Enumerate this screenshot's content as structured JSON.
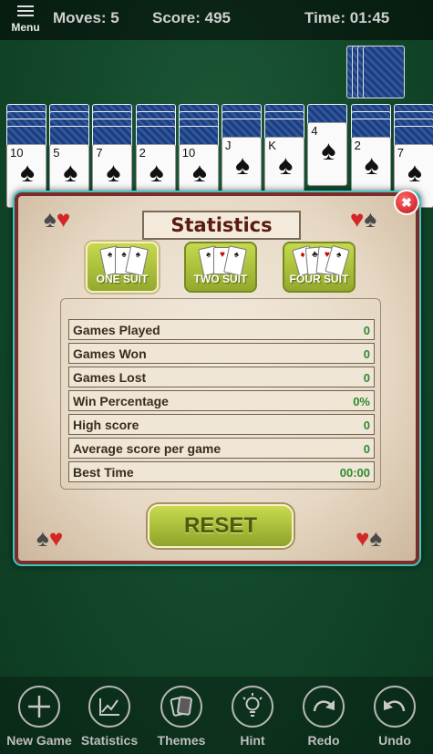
{
  "topbar": {
    "menu_label": "Menu",
    "moves": "Moves: 5",
    "score": "Score: 495",
    "time": "Time: 01:45"
  },
  "board": {
    "columns": [
      {
        "backs": 4,
        "face_rank": "10",
        "face_suit": "♠"
      },
      {
        "backs": 4,
        "face_rank": "5",
        "face_suit": "♠"
      },
      {
        "backs": 4,
        "face_rank": "7",
        "face_suit": "♠"
      },
      {
        "backs": 4,
        "face_rank": "2",
        "face_suit": "♠"
      },
      {
        "backs": 4,
        "face_rank": "10",
        "face_suit": "♠"
      },
      {
        "backs": 3,
        "face_rank": "J",
        "face_suit": "♠"
      },
      {
        "backs": 3,
        "face_rank": "K",
        "face_suit": "♠"
      },
      {
        "backs": 1,
        "face_rank": "4",
        "face_suit": "♠"
      },
      {
        "backs": 3,
        "face_rank": "2",
        "face_suit": "♠"
      },
      {
        "backs": 4,
        "face_rank": "7",
        "face_suit": "♠"
      }
    ]
  },
  "dialog": {
    "title": "Statistics",
    "close_symbol": "✖",
    "suit_buttons": [
      {
        "label": "ONE SUIT",
        "selected": true
      },
      {
        "label": "TWO SUIT",
        "selected": false
      },
      {
        "label": "FOUR SUIT",
        "selected": false
      }
    ],
    "rows": [
      {
        "label": "Games Played",
        "value": "0"
      },
      {
        "label": "Games Won",
        "value": "0"
      },
      {
        "label": "Games Lost",
        "value": "0"
      },
      {
        "label": "Win Percentage",
        "value": "0%"
      },
      {
        "label": "High score",
        "value": "0"
      },
      {
        "label": "Average score per game",
        "value": "0"
      },
      {
        "label": "Best Time",
        "value": "00:00"
      }
    ],
    "reset_label": "RESET"
  },
  "toolbar": {
    "items": [
      {
        "label": "New Game",
        "icon": "plus-icon"
      },
      {
        "label": "Statistics",
        "icon": "chart-icon"
      },
      {
        "label": "Themes",
        "icon": "cards-icon"
      },
      {
        "label": "Hint",
        "icon": "lightbulb-icon"
      },
      {
        "label": "Redo",
        "icon": "redo-icon"
      },
      {
        "label": "Undo",
        "icon": "undo-icon"
      }
    ]
  }
}
